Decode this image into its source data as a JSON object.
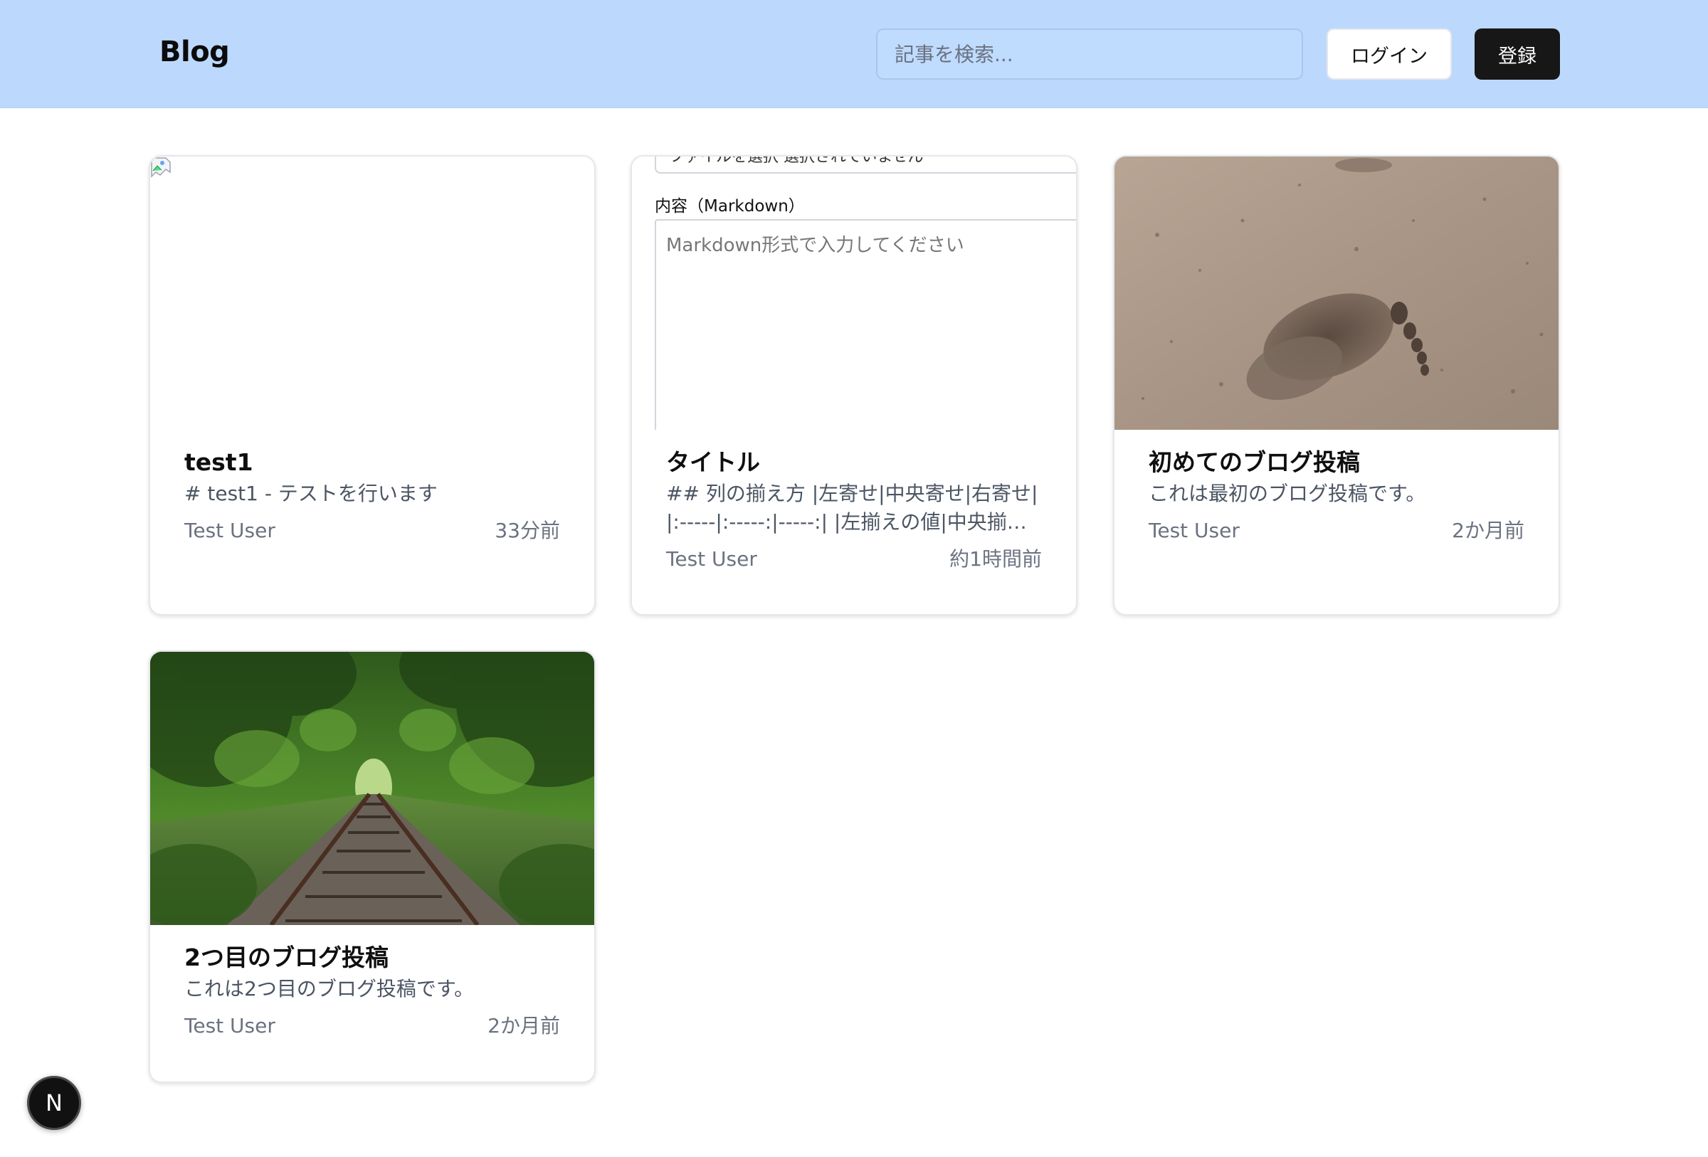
{
  "header": {
    "brand": "Blog",
    "search_placeholder": "記事を検索...",
    "login_label": "ログイン",
    "register_label": "登録"
  },
  "posts": [
    {
      "title": "test1",
      "excerpt": "# test1 - テストを行います",
      "author": "Test User",
      "time": "33分前",
      "image": "broken-image-icon"
    },
    {
      "title": "タイトル",
      "excerpt": "## 列の揃え方 |左寄せ|中央寄せ|右寄せ| |:-----|:-----:|-----:| |左揃えの値|中央揃えの値|右揃えの値|",
      "author": "Test User",
      "time": "約1時間前",
      "image_preview": {
        "file_text": "ファイルを選択 選択されていません",
        "content_label": "内容（Markdown）",
        "textarea_placeholder": "Markdown形式で入力してください"
      }
    },
    {
      "title": "初めてのブログ投稿",
      "excerpt": "これは最初のブログ投稿です。",
      "author": "Test User",
      "time": "2か月前",
      "image": "footprint-in-sand-photo"
    },
    {
      "title": "2つ目のブログ投稿",
      "excerpt": "これは2つ目のブログ投稿です。",
      "author": "Test User",
      "time": "2か月前",
      "image": "railroad-in-forest-photo"
    }
  ],
  "dev_badge": {
    "label": "N"
  },
  "colors": {
    "header_bg": "#bcd9fd",
    "register_bg": "#171717",
    "card_border": "#e5e7eb",
    "muted_text": "#6b7280"
  }
}
